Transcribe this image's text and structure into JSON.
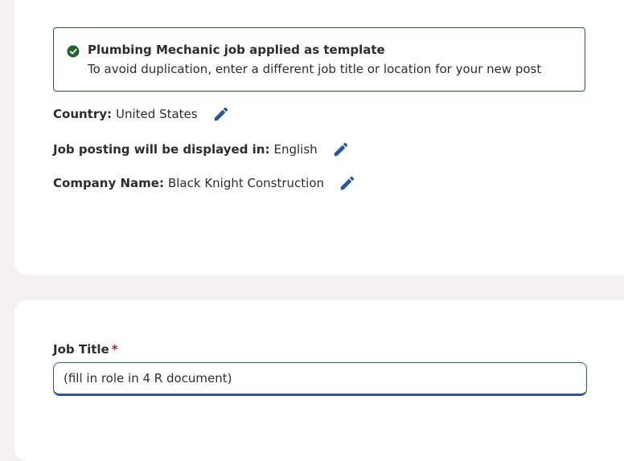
{
  "alert": {
    "title": "Plumbing Mechanic job applied as template",
    "body": "To avoid duplication, enter a different job title or location for your new post",
    "icon": "check-circle-icon",
    "color": "#1f662c"
  },
  "details": {
    "country_label": "Country:",
    "country_value": "United States",
    "language_label": "Job posting will be displayed in:",
    "language_value": "English",
    "company_label": "Company Name:",
    "company_value": "Black Knight Construction",
    "edit_icon": "pencil-icon",
    "accent_color": "#2557a7"
  },
  "job_title": {
    "label": "Job Title",
    "required_marker": "*",
    "value": "(fill in role in 4 R document)"
  }
}
